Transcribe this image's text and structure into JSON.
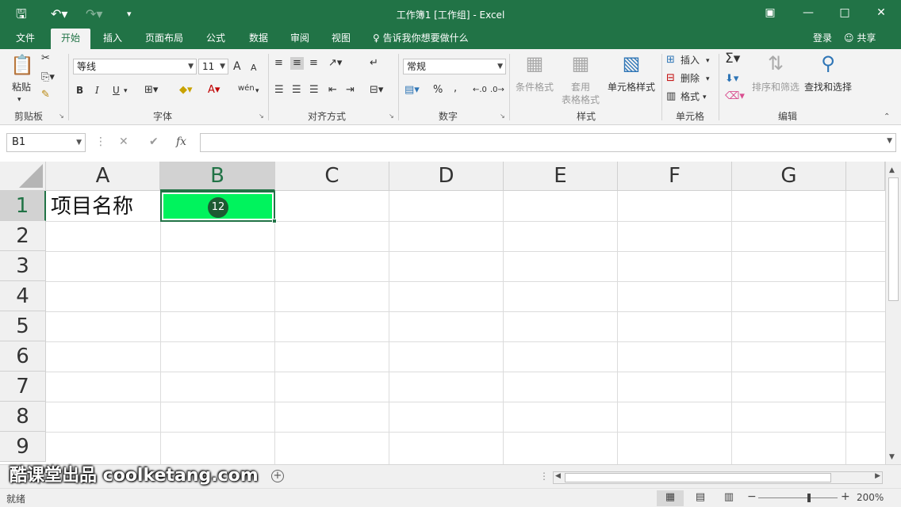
{
  "titlebar": {
    "title": "工作簿1 [工作组] - Excel",
    "save_icon": "save-icon",
    "undo_icon": "undo-icon",
    "redo_icon": "redo-icon",
    "customize_icon": "customize-icon"
  },
  "tabs": [
    {
      "label": "文件"
    },
    {
      "label": "开始"
    },
    {
      "label": "插入"
    },
    {
      "label": "页面布局"
    },
    {
      "label": "公式"
    },
    {
      "label": "数据"
    },
    {
      "label": "审阅"
    },
    {
      "label": "视图"
    }
  ],
  "tell_me": "告诉我你想要做什么",
  "sign_in": "登录",
  "share": "共享",
  "ribbon": {
    "clipboard": {
      "label": "剪贴板",
      "paste": "粘贴"
    },
    "font": {
      "label": "字体",
      "font_name": "等线",
      "font_size": "11",
      "bold": "B",
      "italic": "I",
      "underline": "U",
      "wen": "wén",
      "grow": "A",
      "shrink": "A"
    },
    "alignment": {
      "label": "对齐方式"
    },
    "number": {
      "label": "数字",
      "format": "常规",
      "percent": "%",
      "comma": ","
    },
    "styles": {
      "label": "样式",
      "conditional": "条件格式",
      "table_line1": "套用",
      "table_line2": "表格格式",
      "cell_styles": "单元格样式"
    },
    "cells": {
      "label": "单元格",
      "insert": "插入",
      "delete": "删除",
      "format": "格式"
    },
    "editing": {
      "label": "编辑",
      "sort_filter": "排序和筛选",
      "find_select": "查找和选择"
    }
  },
  "formula_bar": {
    "name_box": "B1",
    "fx": "fx",
    "value": ""
  },
  "columns": [
    "A",
    "B",
    "C",
    "D",
    "E",
    "F",
    "G"
  ],
  "rows": [
    "1",
    "2",
    "3",
    "4",
    "5",
    "6",
    "7",
    "8",
    "9"
  ],
  "cells": {
    "A1": "项目名称",
    "B1_badge": "12"
  },
  "colors": {
    "accent": "#217346",
    "b1_fill": "#00f35d",
    "badge": "#1d5a32"
  },
  "watermark": "酷课堂出品 coolketang.com",
  "status": {
    "ready": "就绪",
    "zoom": "200%"
  }
}
